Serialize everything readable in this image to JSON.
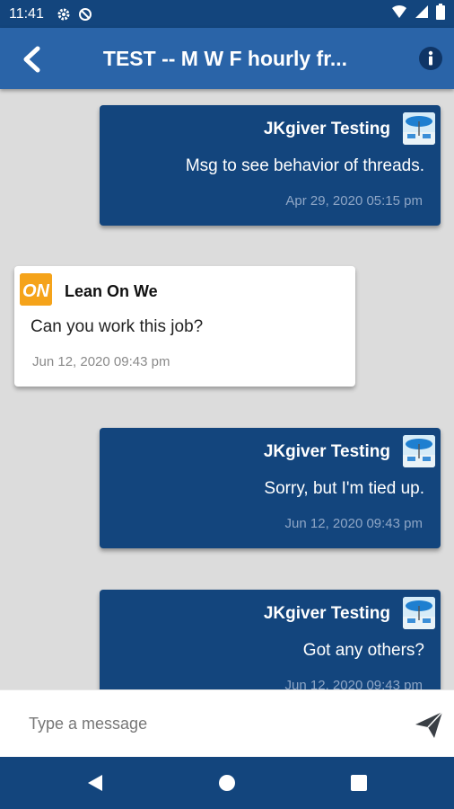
{
  "status_bar": {
    "time": "11:41"
  },
  "header": {
    "title": "TEST -- M W F hourly fr..."
  },
  "messages": [
    {
      "direction": "out",
      "sender": "JKgiver Testing",
      "text": "Msg to see behavior of threads.",
      "timestamp": "Apr 29, 2020  05:15 pm"
    },
    {
      "direction": "in",
      "sender": "Lean On We",
      "text": "Can you work this job?",
      "timestamp": "Jun 12, 2020  09:43 pm"
    },
    {
      "direction": "out",
      "sender": "JKgiver Testing",
      "text": "Sorry, but I'm tied up.",
      "timestamp": "Jun 12, 2020  09:43 pm"
    },
    {
      "direction": "out",
      "sender": "JKgiver Testing",
      "text": "Got any others?",
      "timestamp": "Jun 12, 2020  09:43 pm"
    }
  ],
  "composer": {
    "placeholder": "Type a message"
  },
  "lean_on_we_logo_text": "ON",
  "colors": {
    "status_bar": "#13457d",
    "app_bar": "#2a64a8",
    "outgoing_bubble": "#13457d",
    "incoming_bubble": "#ffffff",
    "background": "#dcdcdc"
  }
}
